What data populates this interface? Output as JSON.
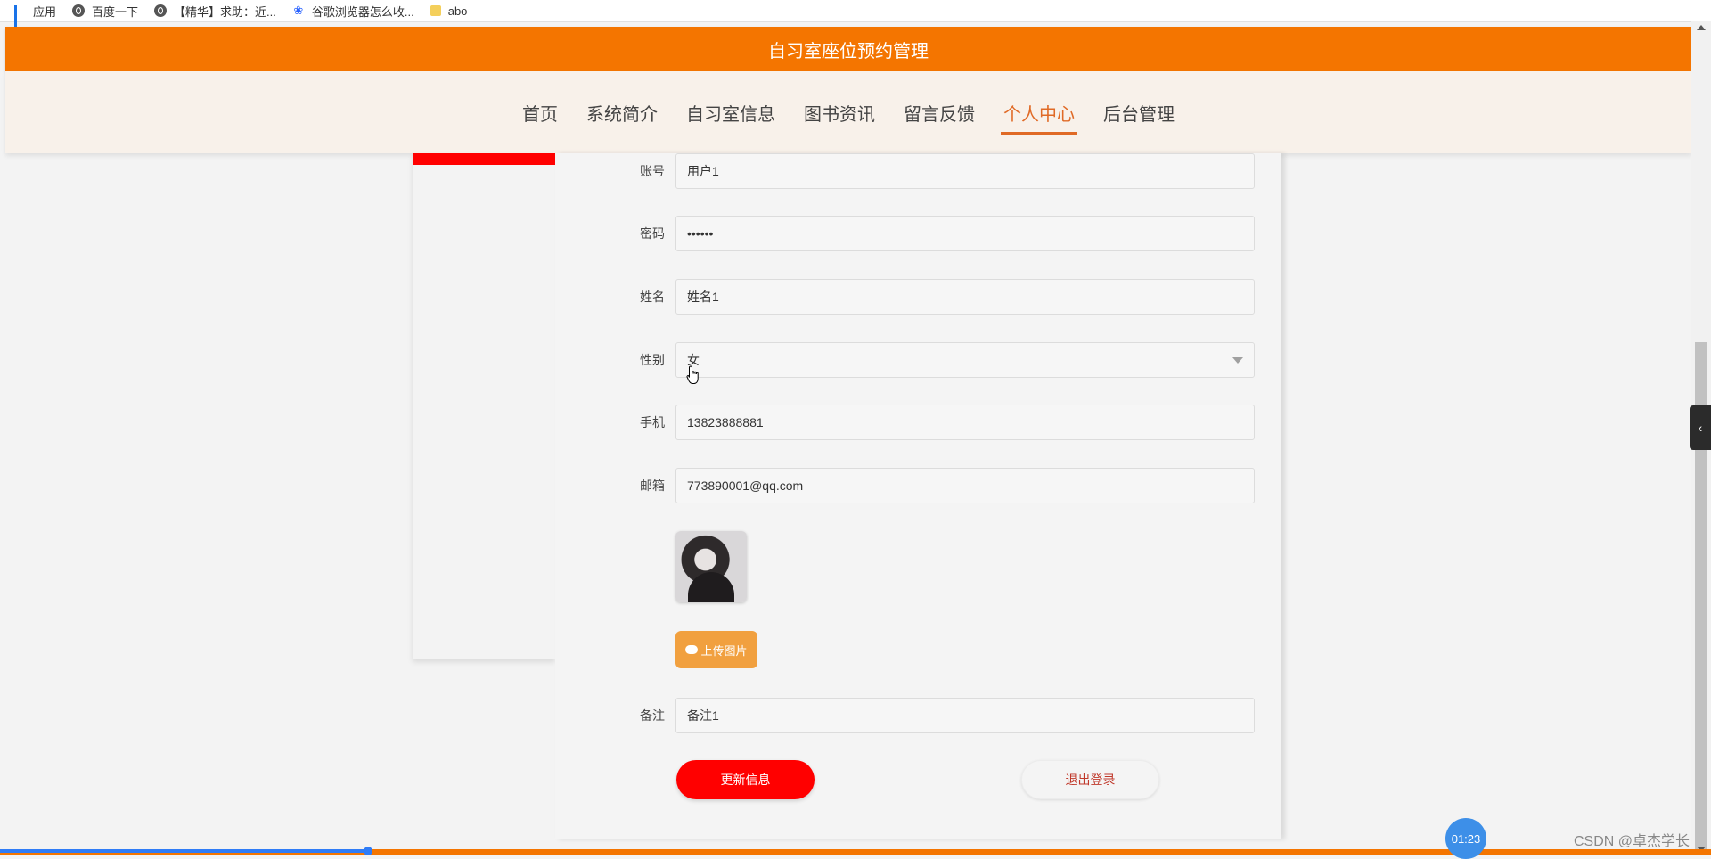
{
  "bookmarks": [
    {
      "label": "应用",
      "icon": "apps-grid-icon"
    },
    {
      "label": "百度一下",
      "icon": "globe-icon"
    },
    {
      "label": "【精华】求助：近...",
      "icon": "globe-icon"
    },
    {
      "label": "谷歌浏览器怎么收...",
      "icon": "baidu-paw-icon"
    },
    {
      "label": "abo",
      "icon": "folder-icon"
    }
  ],
  "header": {
    "title": "自习室座位预约管理"
  },
  "nav": {
    "items": [
      "首页",
      "系统简介",
      "自习室信息",
      "图书资讯",
      "留言反馈",
      "个人中心",
      "后台管理"
    ],
    "active": "个人中心"
  },
  "form": {
    "account": {
      "label": "账号",
      "value": "用户1"
    },
    "password": {
      "label": "密码",
      "value": "••••••"
    },
    "name": {
      "label": "姓名",
      "value": "姓名1"
    },
    "gender": {
      "label": "性别",
      "value": "女"
    },
    "phone": {
      "label": "手机",
      "value": "13823888881"
    },
    "email": {
      "label": "邮箱",
      "value": "773890001@qq.com"
    },
    "upload_label": "上传图片",
    "remark": {
      "label": "备注",
      "value": "备注1"
    },
    "update_label": "更新信息",
    "logout_label": "退出登录"
  },
  "overlay": {
    "timer": "01:23",
    "watermark": "CSDN @卓杰学长"
  },
  "colors": {
    "header": "#f47500",
    "nav_bg": "#f8f1ea",
    "nav_active": "#e06a26",
    "sidebar_accent": "#ff0000",
    "primary_button": "#ff0000",
    "upload_button": "#f1a03f"
  },
  "video_progress": 0.215
}
